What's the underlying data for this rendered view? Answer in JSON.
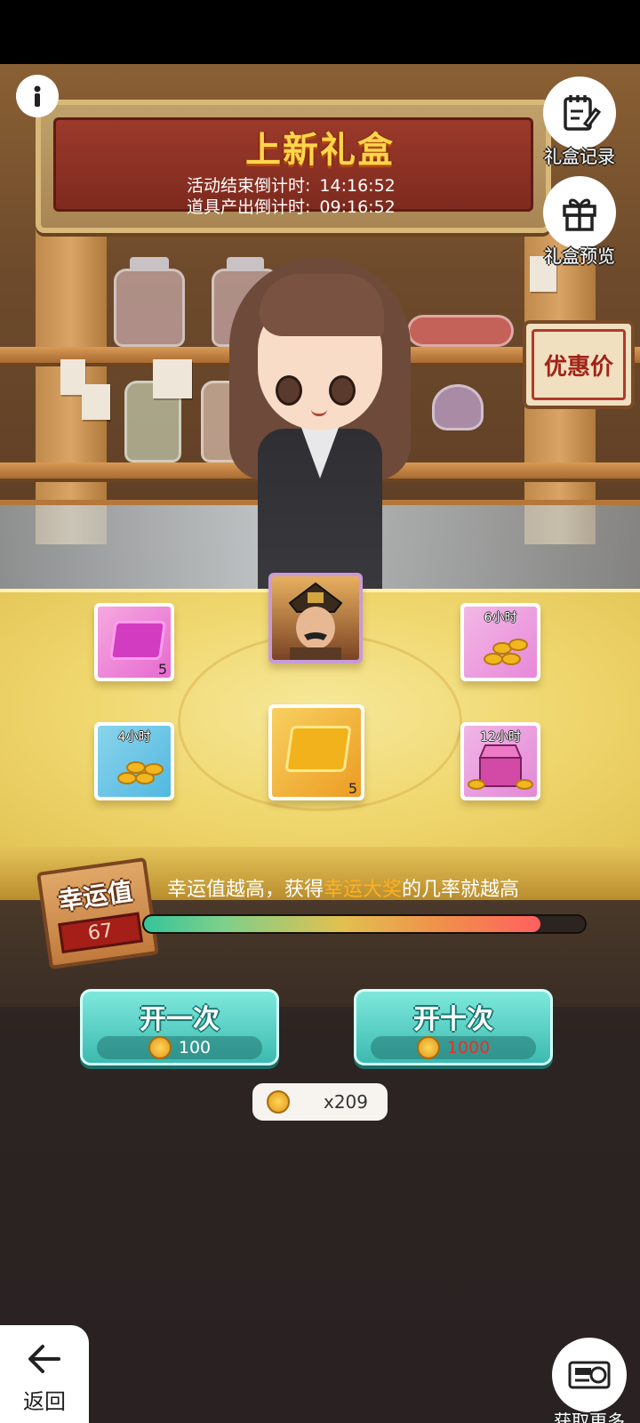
{
  "banner": {
    "title": "上新礼盒",
    "event_end_label": "活动结束倒计时:",
    "event_end_value": "14:16:52",
    "item_output_label": "道具产出倒计时:",
    "item_output_value": "09:16:52"
  },
  "top_right": {
    "records_label": "礼盒记录",
    "preview_label": "礼盒预览"
  },
  "sale_sign": "优惠价",
  "prizes": [
    {
      "name": "pink-ticket",
      "qty": "5",
      "tag": ""
    },
    {
      "name": "general-portrait",
      "qty": "",
      "tag": ""
    },
    {
      "name": "coins-6h",
      "qty": "",
      "tag": "6小时"
    },
    {
      "name": "coins-4h",
      "qty": "",
      "tag": "4小时"
    },
    {
      "name": "gold-ticket",
      "qty": "5",
      "tag": ""
    },
    {
      "name": "chest-12h",
      "qty": "",
      "tag": "12小时"
    }
  ],
  "luck": {
    "label": "幸运值",
    "value": "67",
    "desc_prefix": "幸运值越高，获得",
    "desc_highlight": "幸运大奖",
    "desc_suffix": "的几率就越高",
    "progress_percent": 90
  },
  "open_once": {
    "label": "开一次",
    "cost": "100"
  },
  "open_ten": {
    "label": "开十次",
    "cost": "1000"
  },
  "balance": "x209",
  "nav": {
    "back_label": "返回",
    "more_label": "获取更多"
  },
  "colors": {
    "accent_teal": "#3cbab0",
    "highlight_orange": "#ffb020",
    "cost_red": "#e8312a"
  }
}
